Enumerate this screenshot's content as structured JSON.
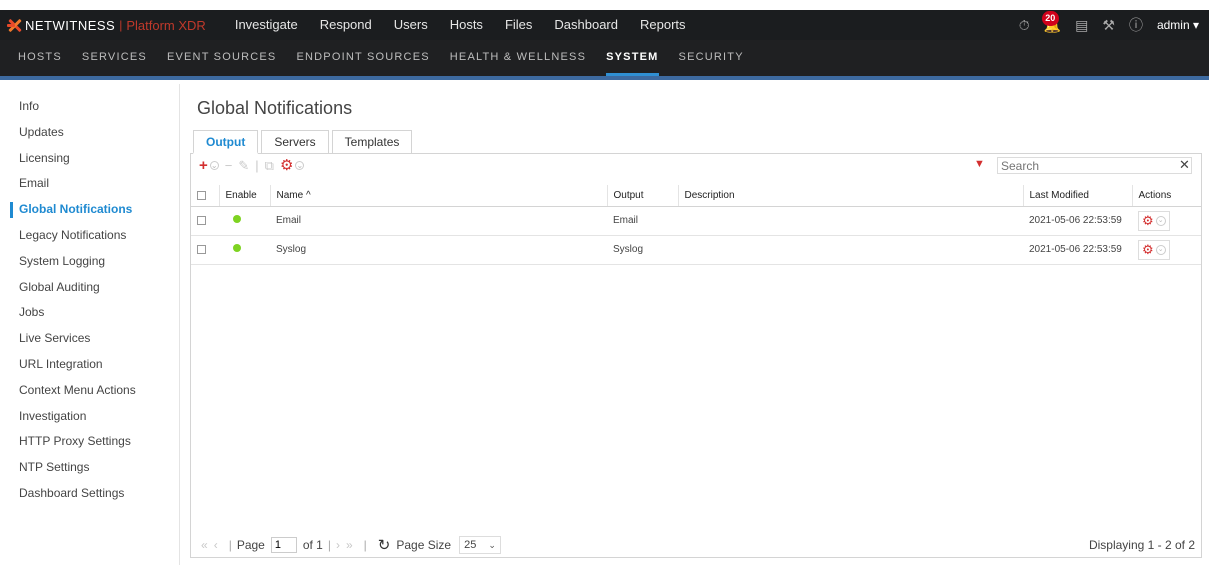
{
  "topbar": {
    "brand": "NETWITNESS",
    "brand_sep": "|",
    "brand_sub": "Platform XDR",
    "nav": [
      "Investigate",
      "Respond",
      "Users",
      "Hosts",
      "Files",
      "Dashboard",
      "Reports"
    ],
    "notif_count": "20",
    "user": "admin"
  },
  "subnav": {
    "items": [
      "HOSTS",
      "SERVICES",
      "EVENT SOURCES",
      "ENDPOINT SOURCES",
      "HEALTH & WELLNESS",
      "SYSTEM",
      "SECURITY"
    ],
    "active": "SYSTEM"
  },
  "sidebar": {
    "items": [
      "Info",
      "Updates",
      "Licensing",
      "Email",
      "Global Notifications",
      "Legacy Notifications",
      "System Logging",
      "Global Auditing",
      "Jobs",
      "Live Services",
      "URL Integration",
      "Context Menu Actions",
      "Investigation",
      "HTTP Proxy Settings",
      "NTP Settings",
      "Dashboard Settings"
    ],
    "active": "Global Notifications"
  },
  "main": {
    "title": "Global Notifications",
    "tabs": [
      "Output",
      "Servers",
      "Templates"
    ],
    "search_placeholder": "Search",
    "columns": [
      "Enable",
      "Name ^",
      "Output",
      "Description",
      "Last Modified",
      "Actions"
    ],
    "rows": [
      {
        "name": "Email",
        "output": "Email",
        "description": "",
        "last_modified": "2021-05-06 22:53:59"
      },
      {
        "name": "Syslog",
        "output": "Syslog",
        "description": "",
        "last_modified": "2021-05-06 22:53:59"
      }
    ]
  },
  "pager": {
    "page_label": "Page",
    "page_value": "1",
    "of_label": "of 1",
    "page_size_label": "Page Size",
    "page_size_value": "25",
    "displaying": "Displaying 1 - 2 of 2"
  },
  "colors": {
    "accent": "#1f8ad1",
    "danger": "#d32f2f",
    "enabled": "#7ed321",
    "topbar": "#1b1d1f"
  }
}
